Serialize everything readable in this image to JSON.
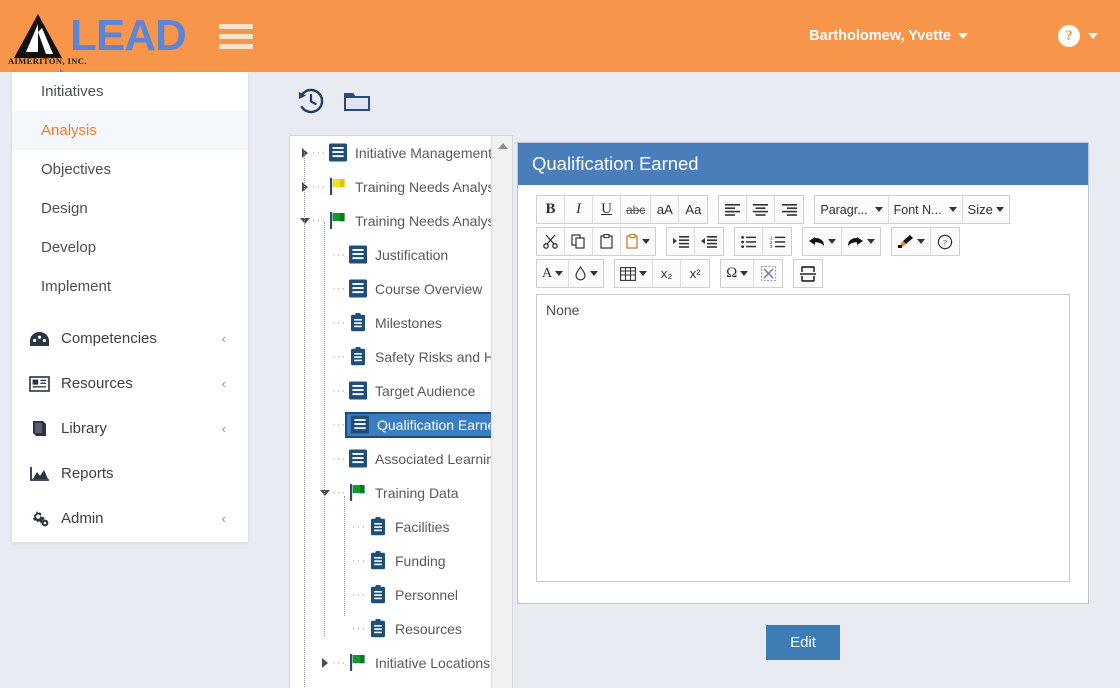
{
  "header": {
    "logo_word": "LEAD",
    "logo_corp": "AIMERITON, INC.",
    "menu_icon": "hamburger-icon",
    "user_name": "Bartholomew, Yvette",
    "help_symbol": "?",
    "brand_orange": "#f7954a",
    "brand_blue": "#5b86d6"
  },
  "sidebar": {
    "items": [
      {
        "label": "Initiatives",
        "active": false
      },
      {
        "label": "Analysis",
        "active": true
      },
      {
        "label": "Objectives",
        "active": false
      },
      {
        "label": "Design",
        "active": false
      },
      {
        "label": "Develop",
        "active": false
      },
      {
        "label": "Implement",
        "active": false
      }
    ],
    "groups": [
      {
        "label": "Competencies",
        "icon": "competencies-icon",
        "chevron": "‹"
      },
      {
        "label": "Resources",
        "icon": "resources-icon",
        "chevron": "‹"
      },
      {
        "label": "Library",
        "icon": "library-icon",
        "chevron": "‹"
      },
      {
        "label": "Reports",
        "icon": "reports-icon",
        "chevron": ""
      },
      {
        "label": "Admin",
        "icon": "admin-gear-icon",
        "chevron": "‹"
      }
    ]
  },
  "actionbar": {
    "history_icon": "history-clock-icon",
    "folder_icon": "folder-icon"
  },
  "tree": {
    "nodes": [
      {
        "label": "Initiative Management",
        "icon": "document-icon",
        "depth": 0,
        "expander": "right",
        "selected": false
      },
      {
        "label": "Training Needs Analysis",
        "icon": "flag-yellow-icon",
        "depth": 0,
        "expander": "right",
        "selected": false
      },
      {
        "label": "Training Needs Analysis",
        "icon": "flag-green-icon",
        "depth": 0,
        "expander": "down",
        "selected": false
      },
      {
        "label": "Justification",
        "icon": "document-icon",
        "depth": 1,
        "expander": "none",
        "selected": false
      },
      {
        "label": "Course Overview",
        "icon": "document-icon",
        "depth": 1,
        "expander": "none",
        "selected": false
      },
      {
        "label": "Milestones",
        "icon": "clipboard-icon",
        "depth": 1,
        "expander": "none",
        "selected": false
      },
      {
        "label": "Safety Risks and Haz",
        "icon": "clipboard-icon",
        "depth": 1,
        "expander": "none",
        "selected": false
      },
      {
        "label": "Target Audience",
        "icon": "document-icon",
        "depth": 1,
        "expander": "none",
        "selected": false
      },
      {
        "label": "Qualification Earned",
        "icon": "document-icon",
        "depth": 1,
        "expander": "none",
        "selected": true
      },
      {
        "label": "Associated Learning E",
        "icon": "document-icon",
        "depth": 1,
        "expander": "none",
        "selected": false
      },
      {
        "label": "Training Data",
        "icon": "flag-green-icon",
        "depth": 1,
        "expander": "down",
        "selected": false
      },
      {
        "label": "Facilities",
        "icon": "clipboard-icon",
        "depth": 2,
        "expander": "none",
        "selected": false
      },
      {
        "label": "Funding",
        "icon": "clipboard-icon",
        "depth": 2,
        "expander": "none",
        "selected": false
      },
      {
        "label": "Personnel",
        "icon": "clipboard-icon",
        "depth": 2,
        "expander": "none",
        "selected": false
      },
      {
        "label": "Resources",
        "icon": "clipboard-icon",
        "depth": 2,
        "expander": "none",
        "selected": false
      },
      {
        "label": "Initiative Locations",
        "icon": "flag-green-icon",
        "depth": 1,
        "expander": "right",
        "selected": false
      }
    ],
    "scroll_up_icon": "scroll-up-arrow-icon"
  },
  "editor": {
    "title": "Qualification Earned",
    "title_bg": "#4a7ebb",
    "content": "None",
    "toolbar": {
      "row1": {
        "format_group": [
          {
            "name": "bold-button",
            "label": "B"
          },
          {
            "name": "italic-button",
            "label": "I"
          },
          {
            "name": "underline-button",
            "label": "U"
          },
          {
            "name": "strikethrough-button",
            "label": "abc"
          },
          {
            "name": "lowercase-button",
            "label": "aA"
          },
          {
            "name": "uppercase-button",
            "label": "Aa"
          }
        ],
        "align_group": [
          {
            "name": "align-left-button",
            "label": "align-left-icon"
          },
          {
            "name": "align-center-button",
            "label": "align-center-icon"
          },
          {
            "name": "align-right-button",
            "label": "align-right-icon"
          }
        ],
        "select_group": [
          {
            "name": "paragraph-format-select",
            "label": "Paragr..."
          },
          {
            "name": "font-name-select",
            "label": "Font N..."
          },
          {
            "name": "font-size-select",
            "label": "Size"
          }
        ]
      },
      "row2": {
        "clipboard_group": [
          {
            "name": "cut-button",
            "label": "scissors-icon"
          },
          {
            "name": "copy-button",
            "label": "copy-icon"
          },
          {
            "name": "paste-button",
            "label": "paste-icon"
          },
          {
            "name": "paste-options-button",
            "label": "paste-dropdown-icon"
          }
        ],
        "indent_group": [
          {
            "name": "increase-indent-button",
            "label": "indent-increase-icon"
          },
          {
            "name": "decrease-indent-button",
            "label": "indent-decrease-icon"
          }
        ],
        "list_group": [
          {
            "name": "bullet-list-button",
            "label": "bullet-list-icon"
          },
          {
            "name": "numbered-list-button",
            "label": "numbered-list-icon"
          }
        ],
        "history_group": [
          {
            "name": "undo-button",
            "label": "undo-arrow-icon"
          },
          {
            "name": "redo-button",
            "label": "redo-arrow-icon"
          }
        ],
        "misc_group": [
          {
            "name": "format-painter-button",
            "label": "format-painter-icon"
          },
          {
            "name": "help-button",
            "label": "?"
          }
        ]
      },
      "row3": {
        "color_group": [
          {
            "name": "text-color-button",
            "label": "A"
          },
          {
            "name": "background-color-button",
            "label": "droplet-icon"
          }
        ],
        "insert_group": [
          {
            "name": "table-button",
            "label": "table-icon"
          },
          {
            "name": "subscript-button",
            "label": "x₂"
          },
          {
            "name": "superscript-button",
            "label": "x²"
          }
        ],
        "symbol_group": [
          {
            "name": "special-character-button",
            "label": "Ω"
          },
          {
            "name": "insert-image-button",
            "label": "image-placeholder-icon"
          }
        ],
        "break_group": [
          {
            "name": "page-break-button",
            "label": "page-break-icon"
          }
        ]
      }
    },
    "edit_button": "Edit"
  }
}
